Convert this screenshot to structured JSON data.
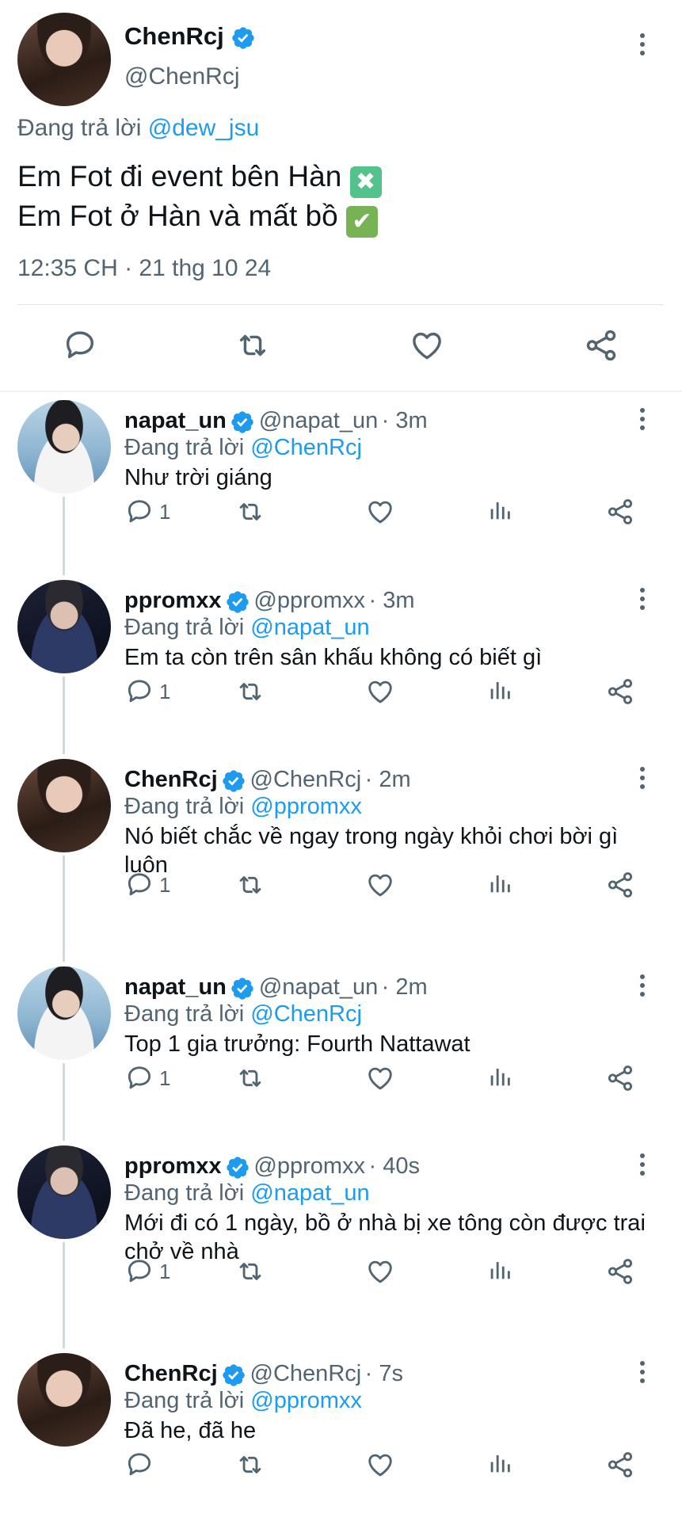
{
  "main_tweet": {
    "display_name": "ChenRcj",
    "handle": "@ChenRcj",
    "reply_prefix": "Đang trả lời",
    "reply_mention": "@dew_jsu",
    "line1_text": "Em Fot đi event bên Hàn",
    "line1_emoji": "✖",
    "line2_text": "Em Fot ở Hàn và mất bồ",
    "line2_emoji": "✔",
    "timestamp": "12:35 CH · 21 thg 10 24"
  },
  "replies": [
    {
      "display_name": "napat_un",
      "handle": "@napat_un",
      "time": "· 3m",
      "reply_prefix": "Đang trả lời",
      "reply_mention": "@ChenRcj",
      "text": "Như trời giáng",
      "reply_count": "1"
    },
    {
      "display_name": "ppromxx",
      "handle": "@ppromxx",
      "time": "· 3m",
      "reply_prefix": "Đang trả lời",
      "reply_mention": "@napat_un",
      "text": "Em ta còn trên sân khấu không có biết gì",
      "reply_count": "1"
    },
    {
      "display_name": "ChenRcj",
      "handle": "@ChenRcj",
      "time": "· 2m",
      "reply_prefix": "Đang trả lời",
      "reply_mention": "@ppromxx",
      "text": "Nó biết chắc về ngay trong ngày khỏi chơi bời gì luôn",
      "reply_count": "1"
    },
    {
      "display_name": "napat_un",
      "handle": "@napat_un",
      "time": "· 2m",
      "reply_prefix": "Đang trả lời",
      "reply_mention": "@ChenRcj",
      "text": "Top 1 gia trưởng: Fourth Nattawat",
      "reply_count": "1"
    },
    {
      "display_name": "ppromxx",
      "handle": "@ppromxx",
      "time": "· 40s",
      "reply_prefix": "Đang trả lời",
      "reply_mention": "@napat_un",
      "text": "Mới đi có 1 ngày, bồ ở nhà bị xe tông còn được trai chở về nhà",
      "reply_count": "1"
    },
    {
      "display_name": "ChenRcj",
      "handle": "@ChenRcj",
      "time": "· 7s",
      "reply_prefix": "Đang trả lời",
      "reply_mention": "@ppromxx",
      "text": "Đã he, đã he",
      "reply_count": ""
    }
  ],
  "icons": {
    "verified": "verified-badge-icon",
    "more": "more-vertical-icon",
    "reply": "reply-icon",
    "retweet": "retweet-icon",
    "like": "like-icon",
    "views": "views-icon",
    "share": "share-icon"
  },
  "colors": {
    "accent": "#1d9bf0",
    "text": "#0f1419",
    "secondary": "#536471",
    "cross_emoji_bg": "#53c28b",
    "check_emoji_bg": "#77b255"
  }
}
